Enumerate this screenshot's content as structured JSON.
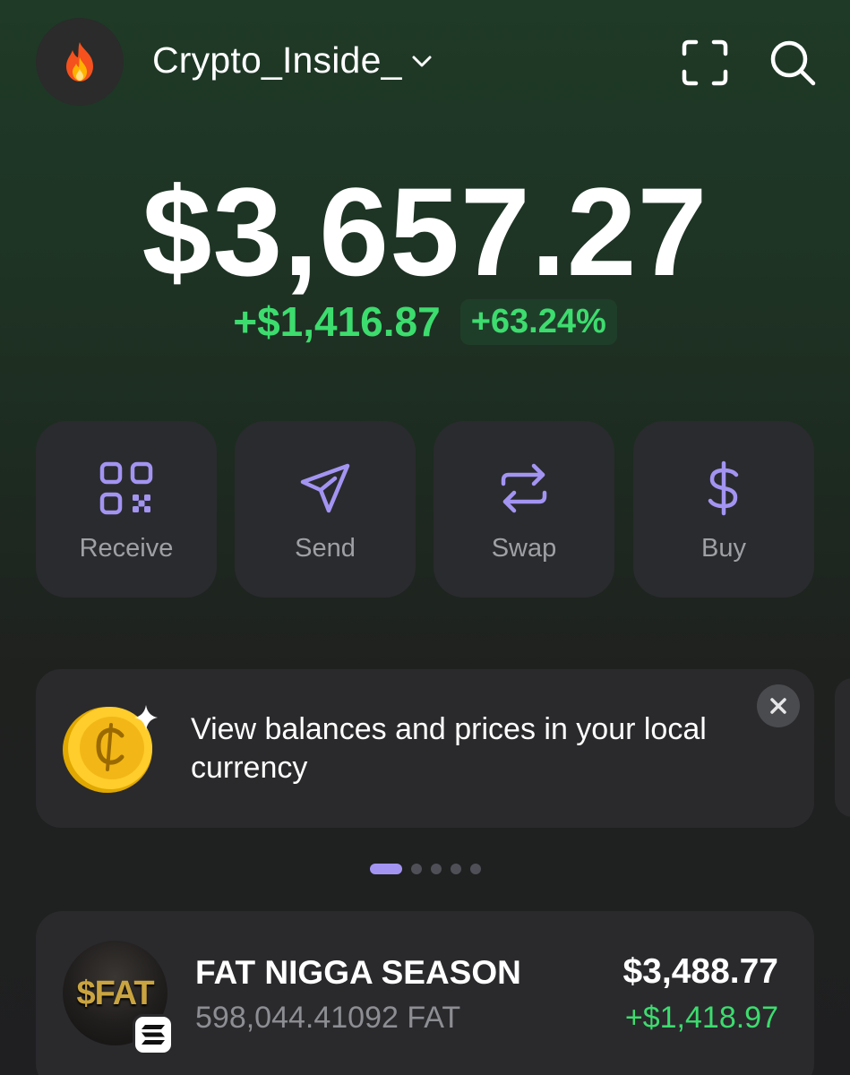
{
  "header": {
    "avatar_icon": "fire-emoji-icon",
    "account_name": "Crypto_Inside_",
    "scan_icon": "scan-icon",
    "search_icon": "search-icon"
  },
  "portfolio": {
    "balance": "$3,657.27",
    "change_amount": "+$1,416.87",
    "change_percent": "+63.24%",
    "positive_color": "#3ddc6e"
  },
  "actions": [
    {
      "label": "Receive",
      "icon": "qr-code-icon"
    },
    {
      "label": "Send",
      "icon": "paper-plane-icon"
    },
    {
      "label": "Swap",
      "icon": "swap-arrows-icon"
    },
    {
      "label": "Buy",
      "icon": "dollar-icon"
    }
  ],
  "accent_color": "#a394f2",
  "banner": {
    "icon": "coin-sparkle-icon",
    "text": "View balances and prices in your local currency",
    "close_icon": "close-icon"
  },
  "carousel": {
    "pages": 5,
    "active_index": 0
  },
  "tokens": [
    {
      "logo_text": "$FAT",
      "chain_icon": "solana-icon",
      "name": "FAT NIGGA SEASON",
      "quantity": "598,044.41092 FAT",
      "value": "$3,488.77",
      "change": "+$1,418.97"
    }
  ]
}
